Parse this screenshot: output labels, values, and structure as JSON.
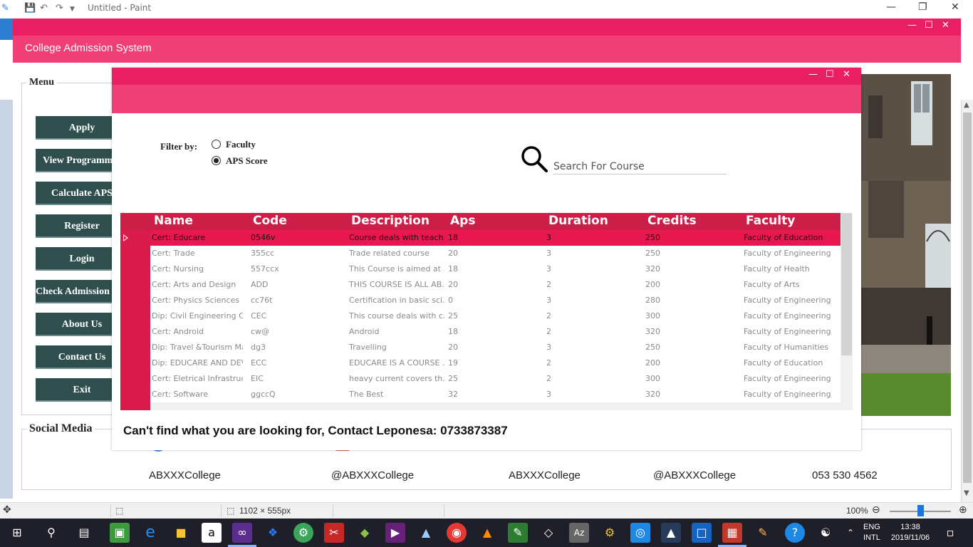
{
  "paint": {
    "title": "Untitled - Paint",
    "status_dimensions": "1102 × 555px",
    "zoom": "100%"
  },
  "app": {
    "title": "College Admission System",
    "menu_title": "Menu",
    "menu_items": [
      "Apply",
      "View Programmes",
      "Calculate APS",
      "Register",
      "Login",
      "Check Admission Status",
      "About Us",
      "Contact Us",
      "Exit"
    ],
    "social_title": "Social Media",
    "social": [
      {
        "icon": "facebook-icon",
        "text": "ABXXXCollege"
      },
      {
        "icon": "instagram-icon",
        "text": "@ABXXXCollege"
      },
      {
        "icon": "linkedin-icon",
        "text": "ABXXXCollege"
      },
      {
        "icon": "twitter-icon",
        "text": "@ABXXXCollege"
      },
      {
        "icon": "phone-icon",
        "text": "053 530 4562"
      }
    ]
  },
  "dialog": {
    "filter_label": "Filter by:",
    "filter_options": [
      {
        "label": "Faculty",
        "checked": false
      },
      {
        "label": "APS Score",
        "checked": true
      }
    ],
    "search_placeholder": "Search For Course",
    "contact_text": "Can't find what you are looking for, Contact Leponesa: 0733873387",
    "columns": [
      "Name",
      "Code",
      "Description",
      "Aps",
      "Duration",
      "Credits",
      "Faculty"
    ],
    "rows": [
      [
        "Cert: Educare",
        "0546v",
        "Course deals with teach...",
        "18",
        "3",
        "250",
        "Faculty of Education"
      ],
      [
        "Cert: Trade",
        "355cc",
        "Trade related course",
        "20",
        "3",
        "250",
        "Faculty of Engineering"
      ],
      [
        "Cert: Nursing",
        "557ccx",
        "This Course is aimed at ...",
        "18",
        "3",
        "320",
        "Faculty of Health"
      ],
      [
        "Cert: Arts and Design",
        "ADD",
        "THIS COURSE IS ALL AB...",
        "20",
        "2",
        "200",
        "Faculty of Arts"
      ],
      [
        "Cert: Physics Sciences",
        "cc76t",
        "Certification in basic sci...",
        "0",
        "3",
        "280",
        "Faculty of Engineering"
      ],
      [
        "Dip: Civil Engineering C...",
        "CEC",
        "This course deals with c...",
        "25",
        "2",
        "300",
        "Faculty of Engineering"
      ],
      [
        "Cert: Android",
        "cw@",
        "Android",
        "18",
        "2",
        "320",
        "Faculty of Engineering"
      ],
      [
        "Dip: Travel &Tourism Ma...",
        "dg3",
        "Travelling",
        "20",
        "3",
        "250",
        "Faculty of Humanities"
      ],
      [
        "Dip: EDUCARE AND DEV...",
        "ECC",
        "EDUCARE IS A COURSE ...",
        "19",
        "2",
        "200",
        "Faculty of Education"
      ],
      [
        "Cert: Eletrical Infrastruct...",
        "EIC",
        "heavy current covers th...",
        "25",
        "2",
        "300",
        "Faculty of Engineering"
      ],
      [
        "Cert: Software",
        "ggccQ",
        "The Best",
        "32",
        "3",
        "320",
        "Faculty of Engineering"
      ]
    ],
    "selected_row": 0
  },
  "taskbar": {
    "lang1": "ENG",
    "lang2": "INTL",
    "time": "13:38",
    "date": "2019/11/06"
  }
}
